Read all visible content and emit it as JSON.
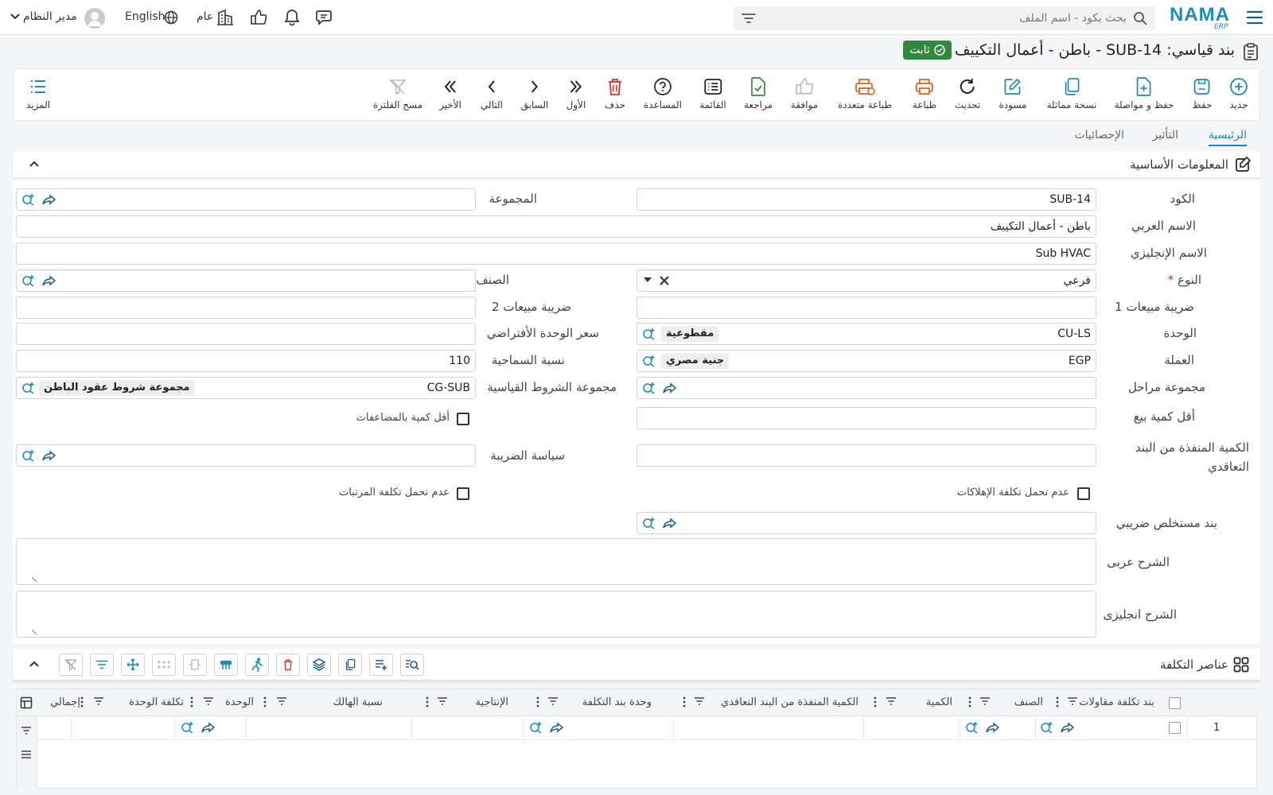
{
  "app": {
    "logo": "NAMA",
    "logo_sub": "ERP",
    "search_placeholder": "بحث بكود - اسم الملف",
    "user_name": "مدير النظام",
    "language": "English",
    "branch": "عام"
  },
  "title": {
    "text": "بند قياسي: SUB-14 - باطن - أعمال التكييف",
    "status": "ثابت",
    "status_color": "#2e8b3e"
  },
  "toolbar": {
    "new": "جديد",
    "save": "حفظ",
    "save_continue": "حفظ و مواصلة",
    "duplicate": "نسخة مماثلة",
    "draft": "مسودة",
    "refresh": "تحديث",
    "print": "طباعة",
    "multi_print": "طباعة متعددة",
    "approve": "موافقة",
    "review": "مراجعة",
    "list": "القائمة",
    "help": "المساعدة",
    "delete": "حذف",
    "first": "الأول",
    "prev": "السابق",
    "next": "التالي",
    "last": "الأخير",
    "clear_filter": "مسح الفلترة",
    "more": "المزيد"
  },
  "tabs": [
    "الرئيسية",
    "التأثير",
    "الإحصائيات"
  ],
  "section": {
    "title": "المعلومات الأساسية"
  },
  "form": {
    "code_label": "الكود",
    "code": "SUB-14",
    "group_label": "المجموعة",
    "arabic_name_label": "الاسم العربي",
    "arabic_name": "باطن - أعمال التكييف",
    "english_name_label": "الاسم الإنجليزي",
    "english_name": "Sub HVAC",
    "type_label": "النوع",
    "type_required": "*",
    "type": "فرعي",
    "category_label": "الصنف",
    "sales_tax1_label": "ضريبة مبيعات 1",
    "sales_tax2_label": "ضريبة مبيعات 2",
    "unit_label": "الوحدة",
    "unit_code": "CU-LS",
    "unit_name": "مقطوعية",
    "default_unit_price_label": "سعر الوحدة الأفتراضي",
    "currency_label": "العملة",
    "currency_code": "EGP",
    "currency_name": "جنية مصري",
    "tolerance_label": "نسبة السماحية",
    "tolerance": "110",
    "stages_group_label": "مجموعة مراحل",
    "std_terms_label": "مجموعة الشروط القياسية",
    "std_terms_code": "CG-SUB",
    "std_terms_name": "مجموعة شروط عقود الباطن",
    "min_sale_qty_label": "أقل كمية بيع",
    "min_qty_multiples_label": "أقل كمية بالمضاعفات",
    "executed_qty_label": "الكمية المنفذة من البند التعاقدي",
    "tax_policy_label": "سياسة الضريبة",
    "no_depreciation_label": "عدم تحمل تكلفة الإهلاكات",
    "no_salaries_label": "عدم تحمل تكلفة المرتبات",
    "tax_deduction_label": "بند مستخلص ضريبي",
    "arabic_desc_label": "الشرح عربى",
    "english_desc_label": "الشرح انجليزى"
  },
  "cost_elements": {
    "title": "عناصر التكلفة",
    "columns": [
      "بند تكلفة مقاولات",
      "الصنف",
      "الكمية",
      "الكمية المنفذة من البند التعاقدي",
      "وحدة بند التكلفة",
      "الإنتاجية",
      "نسبة الهالك",
      "الوحدة",
      "تكلفة الوحدة",
      "إجمالي"
    ],
    "rows": [
      {
        "index": "1"
      }
    ]
  },
  "colors": {
    "accent": "#1a8bc2",
    "danger": "#d93025",
    "print": "#e8601c",
    "review": "#2e8b3e"
  }
}
